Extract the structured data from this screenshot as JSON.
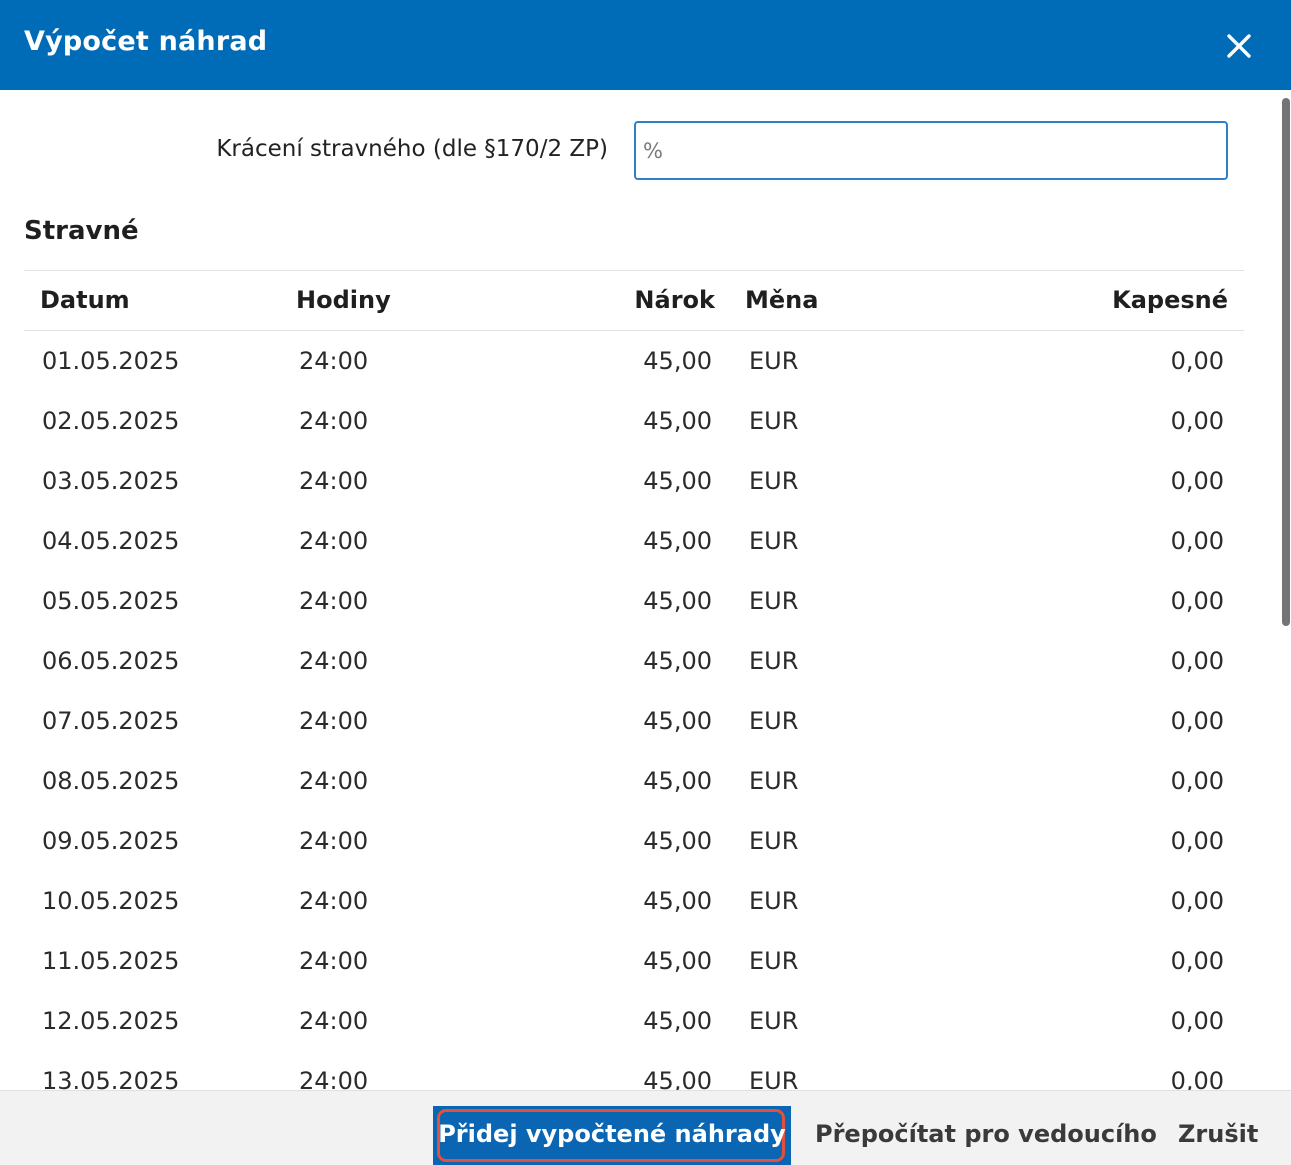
{
  "dialog": {
    "title": "Výpočet náhrad",
    "close_icon": "close-icon"
  },
  "form": {
    "reduction_label": "Krácení stravného (dle §170/2 ZP)",
    "reduction_value": "",
    "reduction_placeholder": "%"
  },
  "section": {
    "title": "Stravné"
  },
  "table": {
    "columns": [
      "Datum",
      "Hodiny",
      "Nárok",
      "Měna",
      "Kapesné"
    ],
    "rows": [
      {
        "datum": "01.05.2025",
        "hodiny": "24:00",
        "narok": "45,00",
        "mena": "EUR",
        "kapesne": "0,00"
      },
      {
        "datum": "02.05.2025",
        "hodiny": "24:00",
        "narok": "45,00",
        "mena": "EUR",
        "kapesne": "0,00"
      },
      {
        "datum": "03.05.2025",
        "hodiny": "24:00",
        "narok": "45,00",
        "mena": "EUR",
        "kapesne": "0,00"
      },
      {
        "datum": "04.05.2025",
        "hodiny": "24:00",
        "narok": "45,00",
        "mena": "EUR",
        "kapesne": "0,00"
      },
      {
        "datum": "05.05.2025",
        "hodiny": "24:00",
        "narok": "45,00",
        "mena": "EUR",
        "kapesne": "0,00"
      },
      {
        "datum": "06.05.2025",
        "hodiny": "24:00",
        "narok": "45,00",
        "mena": "EUR",
        "kapesne": "0,00"
      },
      {
        "datum": "07.05.2025",
        "hodiny": "24:00",
        "narok": "45,00",
        "mena": "EUR",
        "kapesne": "0,00"
      },
      {
        "datum": "08.05.2025",
        "hodiny": "24:00",
        "narok": "45,00",
        "mena": "EUR",
        "kapesne": "0,00"
      },
      {
        "datum": "09.05.2025",
        "hodiny": "24:00",
        "narok": "45,00",
        "mena": "EUR",
        "kapesne": "0,00"
      },
      {
        "datum": "10.05.2025",
        "hodiny": "24:00",
        "narok": "45,00",
        "mena": "EUR",
        "kapesne": "0,00"
      },
      {
        "datum": "11.05.2025",
        "hodiny": "24:00",
        "narok": "45,00",
        "mena": "EUR",
        "kapesne": "0,00"
      },
      {
        "datum": "12.05.2025",
        "hodiny": "24:00",
        "narok": "45,00",
        "mena": "EUR",
        "kapesne": "0,00"
      },
      {
        "datum": "13.05.2025",
        "hodiny": "24:00",
        "narok": "45,00",
        "mena": "EUR",
        "kapesne": "0,00"
      }
    ]
  },
  "footer": {
    "add_label": "Přidej vypočtené náhrady",
    "recalc_label": "Přepočítat pro vedoucího",
    "cancel_label": "Zrušit"
  },
  "colors": {
    "header_bg": "#006bb6",
    "primary_button": "#0a66b3",
    "focus_ring": "#e0513f",
    "input_border": "#2f7fcb"
  }
}
